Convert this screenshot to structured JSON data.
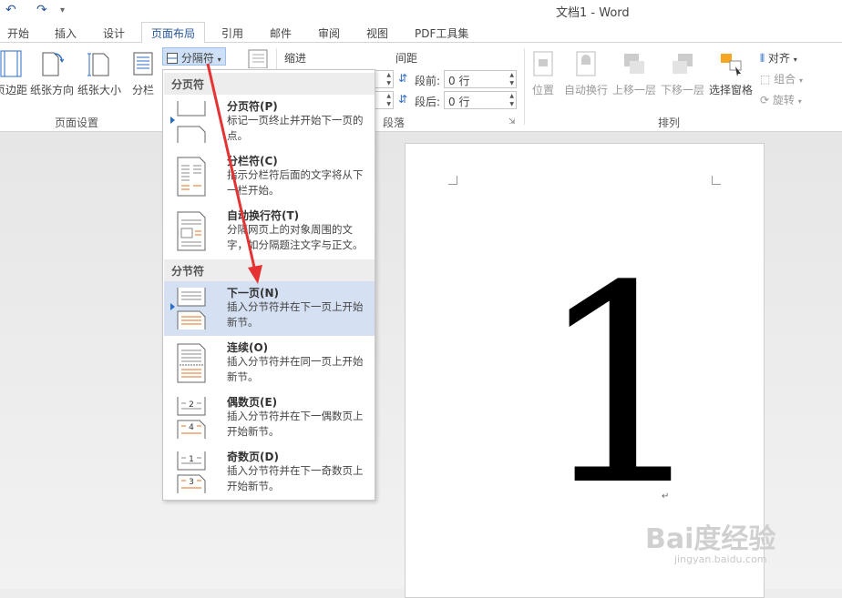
{
  "window": {
    "title": "文档1 - Word"
  },
  "ribbon_tabs": [
    "开始",
    "插入",
    "设计",
    "页面布局",
    "引用",
    "邮件",
    "审阅",
    "视图",
    "PDF工具集"
  ],
  "page_setup": {
    "margins_label": "页边距",
    "orientation_label": "纸张方向",
    "size_label": "纸张大小",
    "columns_label": "分栏",
    "breaks_label": "分隔符",
    "group_label": "页面设置"
  },
  "paragraph": {
    "indent_label": "缩进",
    "spacing_label": "间距",
    "before_label": "段前:",
    "before_value": "0 行",
    "after_label": "段后:",
    "after_value": "0 行",
    "group_label": "段落"
  },
  "arrange": {
    "position_label": "位置",
    "wrap_label": "自动换行",
    "forward_label": "上移一层",
    "backward_label": "下移一层",
    "pane_label": "选择窗格",
    "align_label": "对齐",
    "group_obj_label": "组合",
    "rotate_label": "旋转",
    "group_label": "排列"
  },
  "breaks_menu": {
    "page_breaks_header": "分页符",
    "section_breaks_header": "分节符",
    "items": [
      {
        "title": "分页符(P)",
        "desc": "标记一页终止并开始下一页的点。"
      },
      {
        "title": "分栏符(C)",
        "desc": "指示分栏符后面的文字将从下一栏开始。"
      },
      {
        "title": "自动换行符(T)",
        "desc": "分隔网页上的对象周围的文字，如分隔题注文字与正文。"
      },
      {
        "title": "下一页(N)",
        "desc": "插入分节符并在下一页上开始新节。"
      },
      {
        "title": "连续(O)",
        "desc": "插入分节符并在同一页上开始新节。"
      },
      {
        "title": "偶数页(E)",
        "desc": "插入分节符并在下一偶数页上开始新节。"
      },
      {
        "title": "奇数页(D)",
        "desc": "插入分节符并在下一奇数页上开始新节。"
      }
    ]
  },
  "document": {
    "content": "1"
  },
  "watermark": {
    "brand": "Bai度经验",
    "url": "jingyan.baidu.com"
  },
  "colors": {
    "accent": "#2b579a",
    "annotation": "#e53333",
    "highlight": "#d5e1f2"
  }
}
